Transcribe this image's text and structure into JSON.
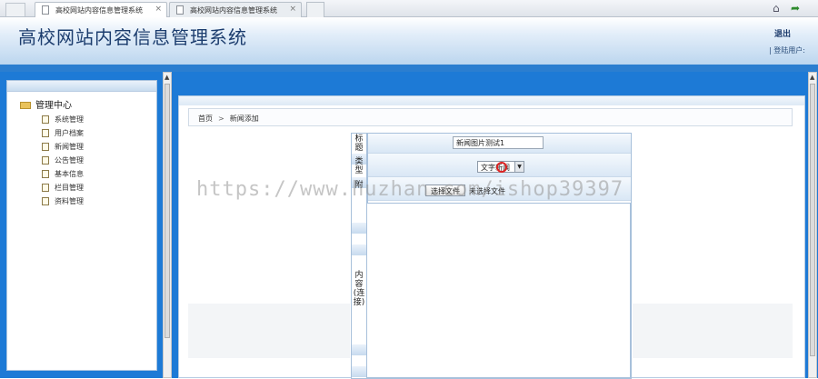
{
  "browser": {
    "tabs": [
      {
        "label": "高校网站内容信息管理系统",
        "close": "×"
      },
      {
        "label": "高校网站内容信息管理系统",
        "close": "×"
      }
    ]
  },
  "header": {
    "title": "高校网站内容信息管理系统",
    "logout": "退出",
    "login_user": "| 登陆用户:"
  },
  "sidebar": {
    "root": "管理中心",
    "items": [
      "系统管理",
      "用户档案",
      "新闻管理",
      "公告管理",
      "基本信息",
      "栏目管理",
      "资料管理"
    ]
  },
  "breadcrumb": {
    "home": "首页",
    "separator": ">",
    "current": "新闻添加"
  },
  "form": {
    "label_title": [
      "标",
      "题"
    ],
    "label_type": [
      "类",
      "型"
    ],
    "label_attach": "附",
    "label_content": [
      "内",
      "容",
      "(连",
      "接)"
    ],
    "title_value": "新闻图片测试1",
    "type_value": "文字新闻",
    "file_button": "选择文件",
    "file_status": "未选择文件"
  },
  "watermark": "https://www.huzhan.com/ishop39397"
}
